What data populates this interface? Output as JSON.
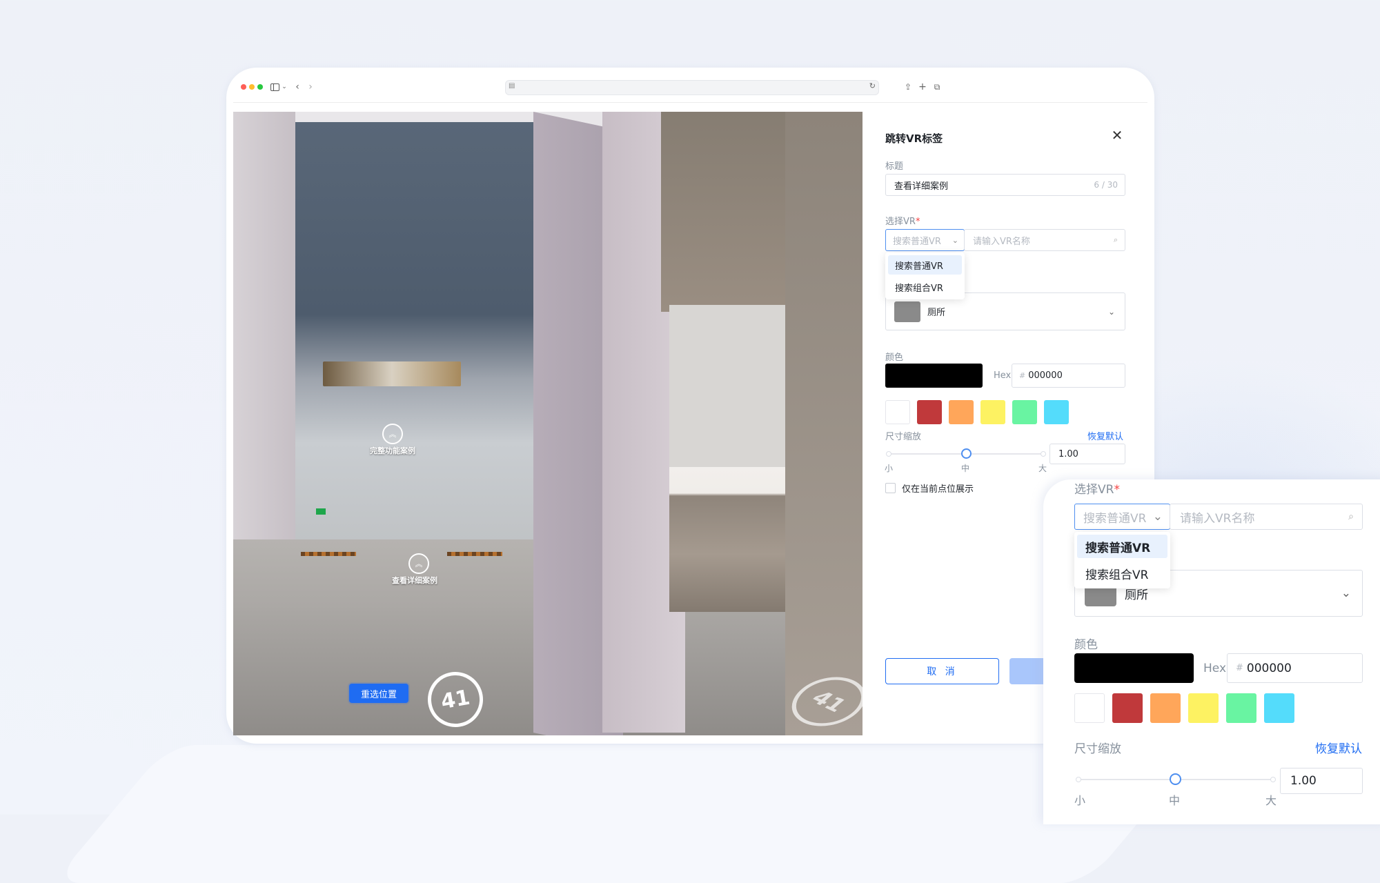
{
  "browser": {
    "traffic_lights": [
      "#fe5f57",
      "#febc2e",
      "#28c840"
    ],
    "icons": [
      "sidebar-icon",
      "chevron-down-icon",
      "back-icon",
      "forward-icon",
      "shield-icon",
      "reload-icon",
      "share-icon",
      "new-tab-icon",
      "tabs-icon"
    ]
  },
  "viewport": {
    "hotspot1_label": "完整功能案例",
    "hotspot2_label": "查看详细案例",
    "reselect_label": "重选位置",
    "badge": "41",
    "badge2": "41"
  },
  "dialog": {
    "title": "跳转VR标签",
    "close_icon": "close-icon",
    "title_label": "标题",
    "title_value": "查看详细案例",
    "title_counter": "6 / 30",
    "select_vr_label": "选择VR",
    "required_mark": "*",
    "vr_type_placeholder": "搜索普通VR",
    "vr_name_placeholder": "请输入VR名称",
    "vr_type_options": [
      "搜索普通VR",
      "搜索组合VR"
    ],
    "icon_select_text": "厕所",
    "color_label": "颜色",
    "hex_label": "Hex",
    "hex_value": "000000",
    "hex_prefix": "#",
    "current_color": "#000000",
    "swatches": [
      "#ffffff",
      "#c0393b",
      "#ffa65a",
      "#fdf262",
      "#69f4a2",
      "#54dcfb"
    ],
    "scale_label": "尺寸缩放",
    "reset_label": "恢复默认",
    "scale_value": "1.00",
    "scale_level": 0.5,
    "scale_ticks": [
      "小",
      "中",
      "大"
    ],
    "only_current_label": "仅在当前点位展示",
    "cancel_label": "取 消"
  },
  "zoom": {
    "select_vr_label": "选择VR",
    "required_mark": "*",
    "vr_type_placeholder": "搜索普通VR",
    "vr_name_placeholder": "请输入VR名称",
    "vr_type_options": [
      "搜索普通VR",
      "搜索组合VR"
    ],
    "icon_select_text": "厕所",
    "color_label": "颜色",
    "hex_label": "Hex",
    "hex_prefix": "#",
    "hex_value": "000000",
    "scale_label": "尺寸缩放",
    "reset_label": "恢复默认",
    "scale_value": "1.00",
    "scale_ticks": [
      "小",
      "中",
      "大"
    ]
  }
}
